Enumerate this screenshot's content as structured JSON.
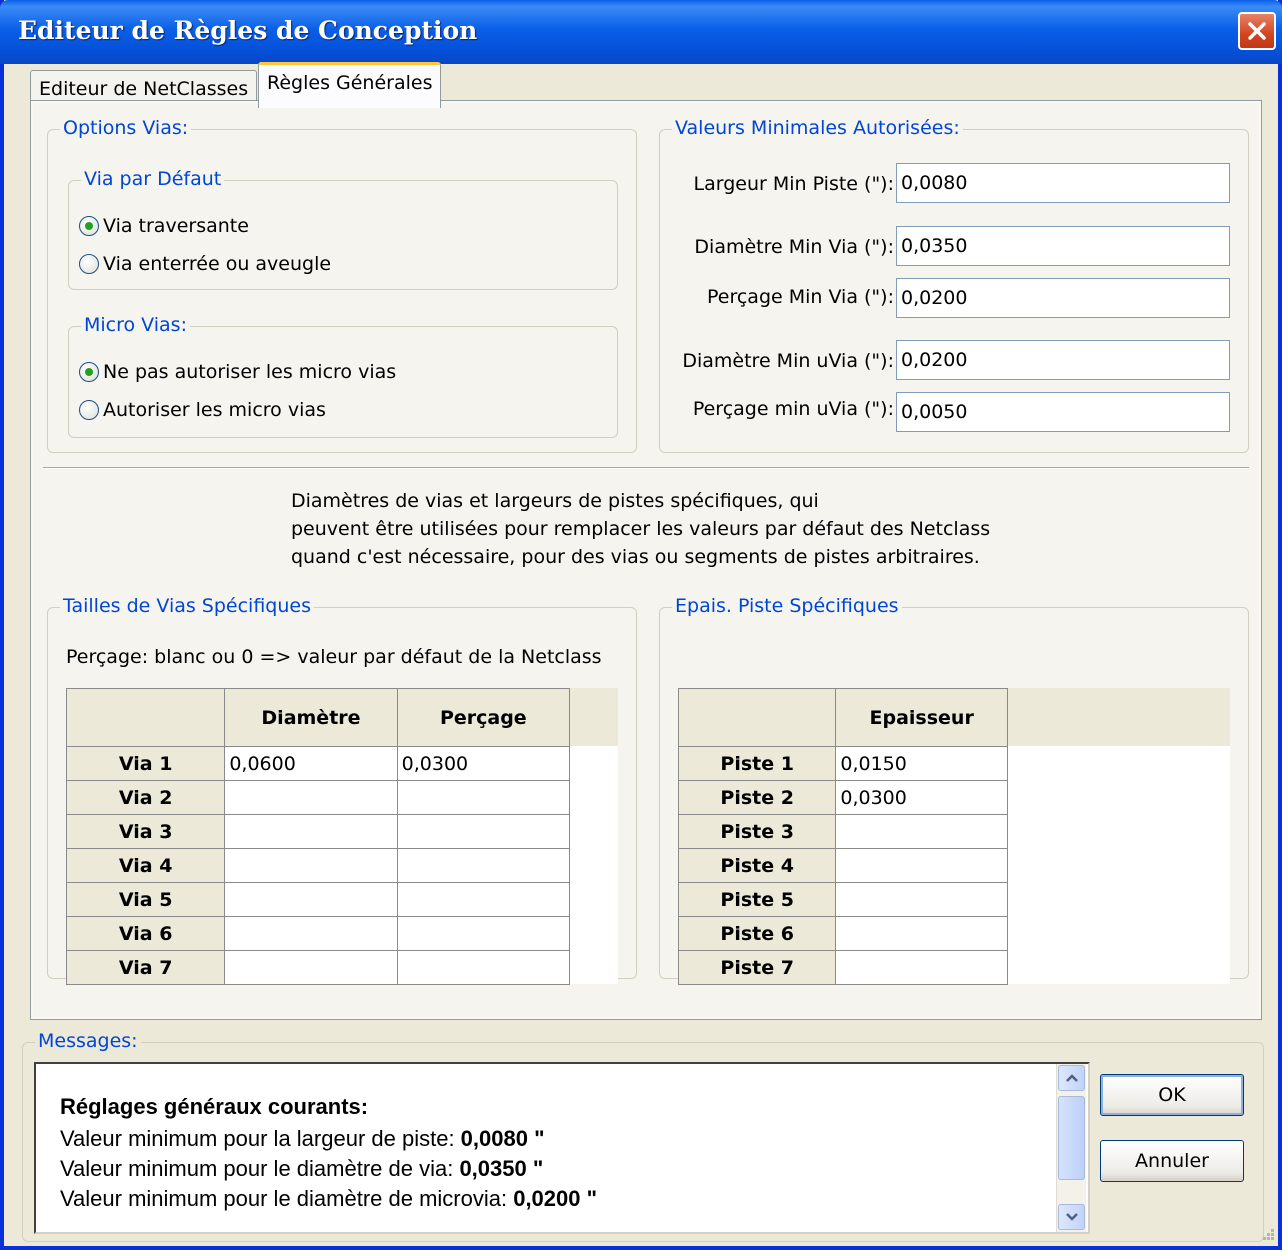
{
  "window": {
    "title": "Editeur de Règles de Conception"
  },
  "tabs": [
    {
      "label": "Editeur de NetClasses"
    },
    {
      "label": "Règles Générales"
    }
  ],
  "via_options": {
    "legend": "Options Vias:",
    "default_via": {
      "legend": "Via par Défaut",
      "options": [
        {
          "label": "Via traversante",
          "checked": true
        },
        {
          "label": "Via enterrée ou aveugle",
          "checked": false
        }
      ]
    },
    "micro_vias": {
      "legend": "Micro Vias:",
      "options": [
        {
          "label": "Ne pas autoriser les micro vias",
          "checked": true
        },
        {
          "label": "Autoriser les micro vias",
          "checked": false
        }
      ]
    }
  },
  "min_values": {
    "legend": "Valeurs Minimales Autorisées:",
    "fields": [
      {
        "label": "Largeur Min Piste (\"):",
        "value": "0,0080"
      },
      {
        "label": "Diamètre Min Via (\"):",
        "value": "0,0350"
      },
      {
        "label": "Perçage Min Via (\"):",
        "value": "0,0200"
      },
      {
        "label": "Diamètre Min uVia (\"):",
        "value": "0,0200"
      },
      {
        "label": "Perçage min uVia (\"):",
        "value": "0,0050"
      }
    ]
  },
  "info": {
    "lines": [
      "Diamètres de vias et largeurs de pistes spécifiques, qui",
      "peuvent être utilisées pour remplacer les valeurs par défaut des Netclass",
      "quand c'est nécessaire, pour des vias ou segments de pistes arbitraires."
    ]
  },
  "via_sizes": {
    "legend": "Tailles de Vias Spécifiques",
    "note": "Perçage: blanc ou 0 => valeur par défaut de la Netclass",
    "columns": [
      "Diamètre",
      "Perçage"
    ],
    "rows": [
      {
        "label": "Via 1",
        "diameter": "0,0600",
        "drill": "0,0300"
      },
      {
        "label": "Via 2",
        "diameter": "",
        "drill": ""
      },
      {
        "label": "Via 3",
        "diameter": "",
        "drill": ""
      },
      {
        "label": "Via 4",
        "diameter": "",
        "drill": ""
      },
      {
        "label": "Via 5",
        "diameter": "",
        "drill": ""
      },
      {
        "label": "Via 6",
        "diameter": "",
        "drill": ""
      },
      {
        "label": "Via 7",
        "diameter": "",
        "drill": ""
      }
    ]
  },
  "track_widths": {
    "legend": "Epais. Piste Spécifiques",
    "columns": [
      "Epaisseur"
    ],
    "rows": [
      {
        "label": "Piste 1",
        "width": "0,0150"
      },
      {
        "label": "Piste 2",
        "width": "0,0300"
      },
      {
        "label": "Piste 3",
        "width": ""
      },
      {
        "label": "Piste 4",
        "width": ""
      },
      {
        "label": "Piste 5",
        "width": ""
      },
      {
        "label": "Piste 6",
        "width": ""
      },
      {
        "label": "Piste 7",
        "width": ""
      }
    ]
  },
  "messages": {
    "legend": "Messages:",
    "heading": "Réglages généraux courants:",
    "lines": [
      {
        "text": "Valeur minimum pour la largeur de piste: ",
        "value": "0,0080 \""
      },
      {
        "text": "Valeur minimum pour le diamètre de via: ",
        "value": "0,0350 \""
      },
      {
        "text": "Valeur minimum pour le diamètre de microvia: ",
        "value": "0,0200 \""
      }
    ]
  },
  "buttons": {
    "ok": "OK",
    "cancel": "Annuler"
  },
  "icons": {
    "close": "close-icon",
    "scroll_up": "chevron-up-icon",
    "scroll_down": "chevron-down-icon",
    "grip": "resize-grip-icon"
  }
}
